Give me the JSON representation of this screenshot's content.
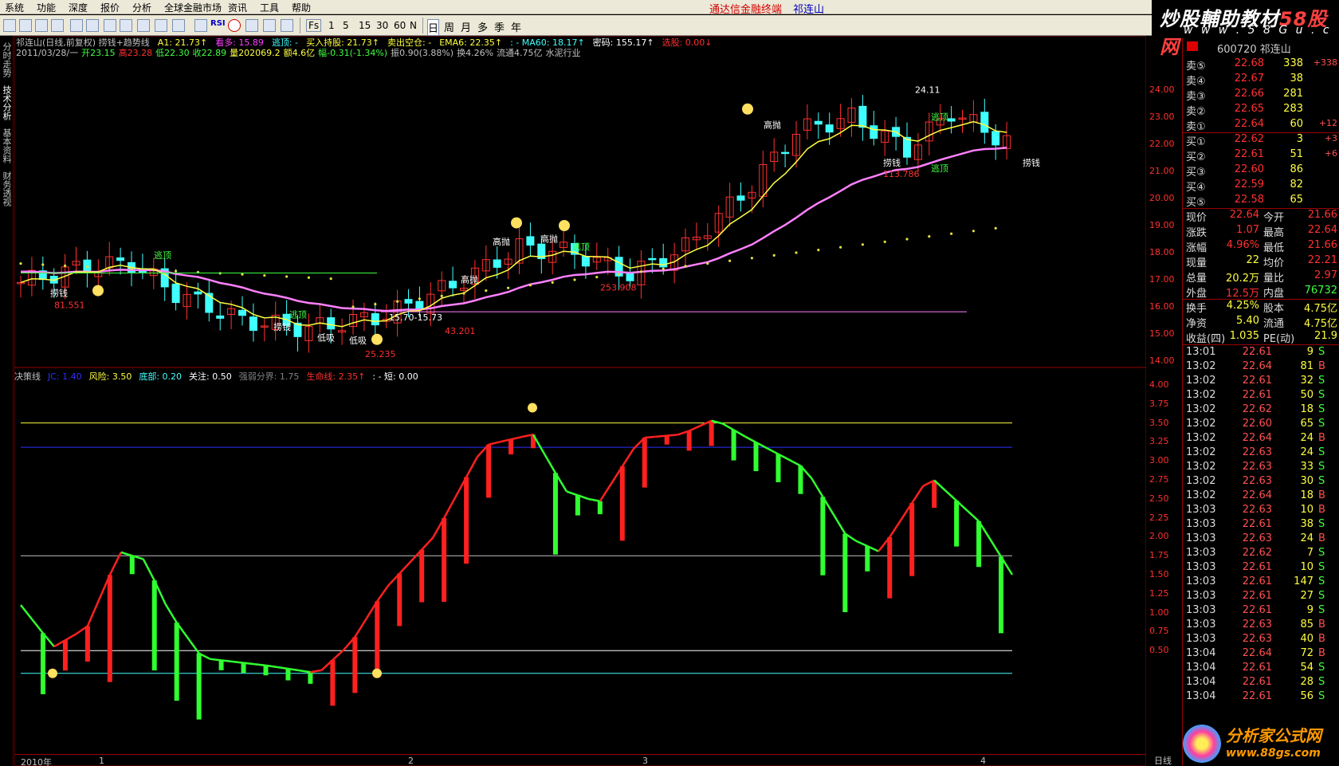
{
  "menu": [
    "系统",
    "功能",
    "深度",
    "报价",
    "分析",
    "全球金融市场",
    "资讯",
    "工具",
    "帮助"
  ],
  "app_title": "通达信金融终端",
  "app_stock": "祁连山",
  "toolbar": {
    "icons": [
      "kline-icon",
      "table-icon",
      "trend-icon",
      "kbar-icon",
      "report-icon",
      "f10-icon",
      "grid-icon",
      "list-icon",
      "fx-icon",
      "f10b-icon",
      "zoom-icon",
      "chart-icon",
      "rsi-icon",
      "money-icon",
      "move-icon",
      "arrow-icon",
      "pen-icon"
    ],
    "rsi_label": "RSI",
    "periods": [
      "1",
      "5",
      "15",
      "30",
      "60",
      "N"
    ],
    "periods_cjk": [
      "日",
      "周",
      "月",
      "多",
      "季",
      "年"
    ],
    "fs_label": "Fs"
  },
  "watermark_top": {
    "main": "炒股輔助教材",
    "accent": "58股网",
    "url": "w w w . 5 8 G u . c o m"
  },
  "leftnav": [
    "分时走势",
    "技术分析",
    "基本资料",
    "财务透视"
  ],
  "main_header": {
    "line1": [
      {
        "text": "祁连山(日线,前复权) 捞钱+趋势线",
        "color": "#c0c0c0"
      },
      {
        "text": "A1: 21.73↑",
        "color": "#ffff40"
      },
      {
        "text": "看多: 15.89",
        "color": "#ff40ff"
      },
      {
        "text": "逃顶: -",
        "color": "#40ffff"
      },
      {
        "text": "买入持股: 21.73↑",
        "color": "#ffff40"
      },
      {
        "text": "卖出空仓: -",
        "color": "#ffff40"
      },
      {
        "text": "EMA6: 22.35↑",
        "color": "#ffff40"
      },
      {
        "text": ": - MA60: 18.17↑",
        "color": "#40ffff"
      },
      {
        "text": "密码: 155.17↑",
        "color": "#ffffff"
      },
      {
        "text": "选股: 0.00↓",
        "color": "#ff3030"
      }
    ],
    "line2": [
      {
        "text": "2011/03/28/一",
        "color": "#c0c0c0"
      },
      {
        "text": "开23.15",
        "color": "#40ff40"
      },
      {
        "text": "高23.28",
        "color": "#ff3030"
      },
      {
        "text": "低22.30",
        "color": "#40ff40"
      },
      {
        "text": "收22.89",
        "color": "#40ff40"
      },
      {
        "text": "量202069.2",
        "color": "#ffff40"
      },
      {
        "text": "额4.6亿",
        "color": "#ffff40"
      },
      {
        "text": "幅-0.31(-1.34%)",
        "color": "#40ff40"
      },
      {
        "text": "振0.90(3.88%)",
        "color": "#c0c0c0"
      },
      {
        "text": "换4.26%",
        "color": "#c0c0c0"
      },
      {
        "text": "流通4.75亿",
        "color": "#c0c0c0"
      },
      {
        "text": "水泥行业",
        "color": "#c0c0c0"
      }
    ]
  },
  "sub_header": [
    {
      "text": "决策线",
      "color": "#c0c0c0"
    },
    {
      "text": "JC: 1.40",
      "color": "#3030ff"
    },
    {
      "text": "风险: 3.50",
      "color": "#ffff40"
    },
    {
      "text": "底部: 0.20",
      "color": "#40ffff"
    },
    {
      "text": "关注: 0.50",
      "color": "#ffffff"
    },
    {
      "text": "强弱分界: 1.75",
      "color": "#808080"
    },
    {
      "text": "生命线: 2.35↑",
      "color": "#ff3030"
    },
    {
      "text": ": - 短: 0.00",
      "color": "#ffffff"
    }
  ],
  "annotations": {
    "labels": [
      {
        "text": "逃顶",
        "color": "#40ff40"
      },
      {
        "text": "捞钱",
        "color": "#ffffff"
      },
      {
        "text": "81.551",
        "color": "#ff3030"
      },
      {
        "text": "逃顶",
        "color": "#40ff40"
      },
      {
        "text": "捞钱",
        "color": "#ffffff"
      },
      {
        "text": "低吸",
        "color": "#ffffff"
      },
      {
        "text": "低吸",
        "color": "#ffffff"
      },
      {
        "text": "25.235",
        "color": "#ff3030"
      },
      {
        "text": "15.70-15.73",
        "color": "#ffffff"
      },
      {
        "text": "43.201",
        "color": "#ff3030"
      },
      {
        "text": "高抛",
        "color": "#ffffff"
      },
      {
        "text": "高抛",
        "color": "#ffffff"
      },
      {
        "text": "高抛",
        "color": "#ffffff"
      },
      {
        "text": "逃顶",
        "color": "#40ff40"
      },
      {
        "text": "253.908",
        "color": "#ff3030"
      },
      {
        "text": "高抛",
        "color": "#ffffff"
      },
      {
        "text": "24.11",
        "color": "#ffffff"
      },
      {
        "text": "逃顶",
        "color": "#40ff40"
      },
      {
        "text": "捞钱",
        "color": "#ffffff"
      },
      {
        "text": "113.786",
        "color": "#ff3030"
      },
      {
        "text": "捞钱",
        "color": "#ffffff"
      },
      {
        "text": "逃顶",
        "color": "#40ff40"
      }
    ]
  },
  "y_axis_main": [
    "24.00",
    "23.00",
    "22.00",
    "21.00",
    "20.00",
    "19.00",
    "18.00",
    "17.00",
    "16.00",
    "15.00",
    "14.00"
  ],
  "y_axis_sub": [
    "4.00",
    "3.75",
    "3.50",
    "3.25",
    "3.00",
    "2.75",
    "2.50",
    "2.25",
    "2.00",
    "1.75",
    "1.50",
    "1.25",
    "1.00",
    "0.75",
    "0.50"
  ],
  "x_axis": [
    "2010年",
    "1",
    "2",
    "3",
    "4"
  ],
  "period_tag": "日线",
  "stock_head": {
    "code": "600720 祁连山"
  },
  "order_book": {
    "asks": [
      {
        "label": "卖⑤",
        "price": "22.68",
        "vol": "338",
        "chg": "+338"
      },
      {
        "label": "卖④",
        "price": "22.67",
        "vol": "38",
        "chg": ""
      },
      {
        "label": "卖③",
        "price": "22.66",
        "vol": "281",
        "chg": ""
      },
      {
        "label": "卖②",
        "price": "22.65",
        "vol": "283",
        "chg": ""
      },
      {
        "label": "卖①",
        "price": "22.64",
        "vol": "60",
        "chg": "+12"
      }
    ],
    "bids": [
      {
        "label": "买①",
        "price": "22.62",
        "vol": "3",
        "chg": "+3"
      },
      {
        "label": "买②",
        "price": "22.61",
        "vol": "51",
        "chg": "+6"
      },
      {
        "label": "买③",
        "price": "22.60",
        "vol": "86",
        "chg": ""
      },
      {
        "label": "买④",
        "price": "22.59",
        "vol": "82",
        "chg": ""
      },
      {
        "label": "买⑤",
        "price": "22.58",
        "vol": "65",
        "chg": ""
      }
    ]
  },
  "quote": [
    {
      "l1": "现价",
      "v1": "22.64",
      "c1": "#ff3030",
      "l2": "今开",
      "v2": "21.66",
      "c2": "#ff3030"
    },
    {
      "l1": "涨跌",
      "v1": "1.07",
      "c1": "#ff3030",
      "l2": "最高",
      "v2": "22.64",
      "c2": "#ff3030"
    },
    {
      "l1": "涨幅",
      "v1": "4.96%",
      "c1": "#ff3030",
      "l2": "最低",
      "v2": "21.66",
      "c2": "#ff3030"
    },
    {
      "l1": "现量",
      "v1": "22",
      "c1": "#ffff40",
      "l2": "均价",
      "v2": "22.21",
      "c2": "#ff3030"
    },
    {
      "l1": "总量",
      "v1": "20.2万",
      "c1": "#ffff40",
      "l2": "量比",
      "v2": "2.97",
      "c2": "#ff3030"
    },
    {
      "l1": "外盘",
      "v1": "12.5万",
      "c1": "#ff3030",
      "l2": "内盘",
      "v2": "76732",
      "c2": "#40ff40"
    },
    {
      "l1": "换手",
      "v1": "4.25%",
      "c1": "#ffff40",
      "l2": "股本",
      "v2": "4.75亿",
      "c2": "#ffff40"
    },
    {
      "l1": "净资",
      "v1": "5.40",
      "c1": "#ffff40",
      "l2": "流通",
      "v2": "4.75亿",
      "c2": "#ffff40"
    },
    {
      "l1": "收益(四)",
      "v1": "1.035",
      "c1": "#ffff40",
      "l2": "PE(动)",
      "v2": "21.9",
      "c2": "#ffff40"
    }
  ],
  "ticks": [
    {
      "t": "13:01",
      "p": "22.61",
      "v": "9",
      "s": "S"
    },
    {
      "t": "13:02",
      "p": "22.64",
      "v": "81",
      "s": "B"
    },
    {
      "t": "13:02",
      "p": "22.61",
      "v": "32",
      "s": "S"
    },
    {
      "t": "13:02",
      "p": "22.61",
      "v": "50",
      "s": "S"
    },
    {
      "t": "13:02",
      "p": "22.62",
      "v": "18",
      "s": "S"
    },
    {
      "t": "13:02",
      "p": "22.60",
      "v": "65",
      "s": "S"
    },
    {
      "t": "13:02",
      "p": "22.64",
      "v": "24",
      "s": "B"
    },
    {
      "t": "13:02",
      "p": "22.63",
      "v": "24",
      "s": "S"
    },
    {
      "t": "13:02",
      "p": "22.63",
      "v": "33",
      "s": "S"
    },
    {
      "t": "13:02",
      "p": "22.63",
      "v": "30",
      "s": "S"
    },
    {
      "t": "13:02",
      "p": "22.64",
      "v": "18",
      "s": "B"
    },
    {
      "t": "13:03",
      "p": "22.63",
      "v": "10",
      "s": "B"
    },
    {
      "t": "13:03",
      "p": "22.61",
      "v": "38",
      "s": "S"
    },
    {
      "t": "13:03",
      "p": "22.63",
      "v": "24",
      "s": "B"
    },
    {
      "t": "13:03",
      "p": "22.62",
      "v": "7",
      "s": "S"
    },
    {
      "t": "13:03",
      "p": "22.61",
      "v": "10",
      "s": "S"
    },
    {
      "t": "13:03",
      "p": "22.61",
      "v": "147",
      "s": "S"
    },
    {
      "t": "13:03",
      "p": "22.61",
      "v": "27",
      "s": "S"
    },
    {
      "t": "13:03",
      "p": "22.61",
      "v": "9",
      "s": "S"
    },
    {
      "t": "13:03",
      "p": "22.63",
      "v": "85",
      "s": "B"
    },
    {
      "t": "13:03",
      "p": "22.63",
      "v": "40",
      "s": "B"
    },
    {
      "t": "13:04",
      "p": "22.64",
      "v": "72",
      "s": "B"
    },
    {
      "t": "13:04",
      "p": "22.61",
      "v": "54",
      "s": "S"
    },
    {
      "t": "13:04",
      "p": "22.61",
      "v": "28",
      "s": "S"
    },
    {
      "t": "13:04",
      "p": "22.61",
      "v": "56",
      "s": "S"
    }
  ],
  "watermark_bottom": {
    "main": "分析家公式网",
    "url": "www.88gs.com"
  },
  "colors": {
    "up": "#ff3030",
    "down": "#40ffff",
    "ema": "#ffff40",
    "ma60": "#ff80ff",
    "decision_up": "#ff2020",
    "decision_down": "#30ff30"
  }
}
